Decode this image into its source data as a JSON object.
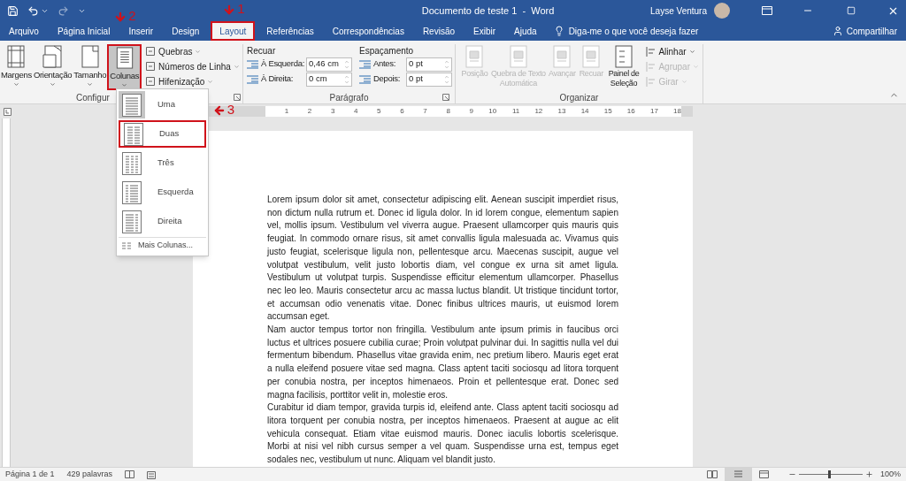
{
  "title_bar": {
    "title": "Documento de teste 1  -  Word",
    "user": "Layse Ventura"
  },
  "tabs": [
    {
      "label": "Arquivo",
      "selected": false
    },
    {
      "label": "Página Inicial",
      "selected": false
    },
    {
      "label": "Inserir",
      "selected": false
    },
    {
      "label": "Design",
      "selected": false
    },
    {
      "label": "Layout",
      "selected": true,
      "annotation": "1"
    },
    {
      "label": "Referências",
      "selected": false
    },
    {
      "label": "Correspondências",
      "selected": false
    },
    {
      "label": "Revisão",
      "selected": false
    },
    {
      "label": "Exibir",
      "selected": false
    },
    {
      "label": "Ajuda",
      "selected": false
    }
  ],
  "tell_me": {
    "placeholder": "Diga-me o que você deseja fazer"
  },
  "share": "Compartilhar",
  "ribbon": {
    "page_setup": {
      "label": "Configur",
      "big_buttons": [
        {
          "label": "Margens",
          "kind": "margins",
          "pressed": false
        },
        {
          "label": "Orientação",
          "kind": "orientation",
          "pressed": false
        },
        {
          "label": "Tamanho",
          "kind": "size",
          "pressed": false
        },
        {
          "label": "Colunas",
          "kind": "columns",
          "pressed": true,
          "annotation": "2"
        }
      ],
      "small_buttons": [
        "Quebras",
        "Números de Linha",
        "Hifenização"
      ]
    },
    "paragraph": {
      "label": "Parágrafo",
      "indent": {
        "heading": "Recuar",
        "fields": [
          {
            "label": "À Esquerda:",
            "value": "0,46 cm"
          },
          {
            "label": "À Direita:",
            "value": "0 cm"
          }
        ]
      },
      "spacing": {
        "heading": "Espaçamento",
        "fields": [
          {
            "label": "Antes:",
            "value": "0 pt"
          },
          {
            "label": "Depois:",
            "value": "0 pt"
          }
        ]
      }
    },
    "arrange": {
      "label": "Organizar",
      "big_buttons": [
        {
          "label": "Posição",
          "disabled": true
        },
        {
          "label": "Quebra de Texto Automática",
          "disabled": true
        },
        {
          "label": "Avançar",
          "disabled": true
        },
        {
          "label": "Recuar",
          "disabled": true
        },
        {
          "label": "Painel de Seleção",
          "disabled": false
        }
      ],
      "small_buttons": [
        {
          "label": "Alinhar",
          "disabled": false
        },
        {
          "label": "Agrupar",
          "disabled": true
        },
        {
          "label": "Girar",
          "disabled": true
        }
      ]
    }
  },
  "ruler": [
    "1",
    "2",
    "3",
    "4",
    "5",
    "6",
    "7",
    "8",
    "9",
    "10",
    "11",
    "12",
    "13",
    "14",
    "15",
    "16",
    "17",
    "18"
  ],
  "columns_menu": {
    "items": [
      {
        "label": "Uma",
        "selected": true
      },
      {
        "label": "Duas",
        "selected": false,
        "annotation": "3"
      },
      {
        "label": "Três",
        "selected": false
      },
      {
        "label": "Esquerda",
        "selected": false
      },
      {
        "label": "Direita",
        "selected": false
      }
    ],
    "more": "Mais Colunas..."
  },
  "document": {
    "paragraphs": [
      "Lorem ipsum dolor sit amet, consectetur adipiscing elit. Aenean suscipit imperdiet risus, non dictum nulla rutrum et. Donec id ligula dolor. In id lorem congue, elementum sapien vel, mollis ipsum. Vestibulum vel viverra augue. Praesent ullamcorper quis mauris quis feugiat. In commodo ornare risus, sit amet convallis ligula malesuada ac. Vivamus quis justo feugiat, scelerisque ligula non, pellentesque arcu. Maecenas suscipit, augue vel volutpat vestibulum, velit justo lobortis diam, vel congue ex urna sit amet ligula. Vestibulum ut volutpat turpis. Suspendisse efficitur elementum ullamcorper. Phasellus nec leo leo. Mauris consectetur arcu ac massa luctus blandit. Ut tristique tincidunt tortor, et accumsan odio venenatis vitae. Donec finibus ultrices mauris, ut euismod lorem accumsan eget.",
      "Nam auctor tempus tortor non fringilla. Vestibulum ante ipsum primis in faucibus orci luctus et ultrices posuere cubilia curae; Proin volutpat pulvinar dui. In sagittis nulla vel dui fermentum bibendum. Phasellus vitae gravida enim, nec pretium libero. Mauris eget erat a nulla eleifend posuere vitae sed magna. Class aptent taciti sociosqu ad litora torquent per conubia nostra, per inceptos himenaeos. Proin et pellentesque erat. Donec sed magna facilisis, porttitor velit in, molestie eros.",
      "Curabitur id diam tempor, gravida turpis id, eleifend ante. Class aptent taciti sociosqu ad litora torquent per conubia nostra, per inceptos himenaeos. Praesent at augue ac elit vehicula consequat. Etiam vitae euismod mauris. Donec iaculis lobortis scelerisque. Morbi at nisi vel nibh cursus semper a vel quam. Suspendisse urna est, tempus eget sodales nec, vestibulum ut nunc. Aliquam vel blandit justo."
    ]
  },
  "status_bar": {
    "page": "Página 1 de 1",
    "words": "429 palavras",
    "zoom": {
      "level": 0.48,
      "reading": "100%"
    }
  }
}
